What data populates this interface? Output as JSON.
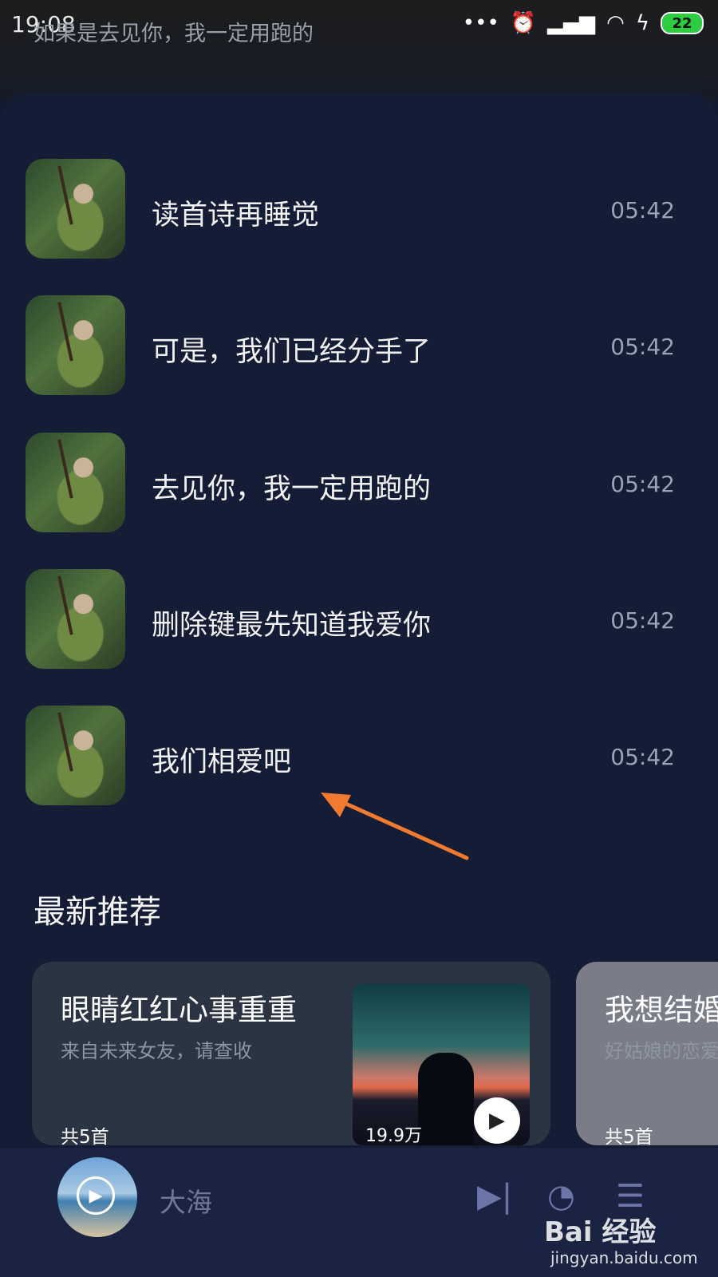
{
  "status_bar": {
    "time": "19:08",
    "notification_text": "如果是去见你，我一定用跑的",
    "battery": "22"
  },
  "songs": [
    {
      "title": "读首诗再睡觉",
      "duration": "05:42"
    },
    {
      "title": "可是，我们已经分手了",
      "duration": "05:42"
    },
    {
      "title": "去见你，我一定用跑的",
      "duration": "05:42"
    },
    {
      "title": "删除键最先知道我爱你",
      "duration": "05:42"
    },
    {
      "title": "我们相爱吧",
      "duration": "05:42"
    }
  ],
  "section": {
    "title": "最新推荐"
  },
  "cards": [
    {
      "title": "眼睛红红心事重重",
      "subtitle": "来自未来女友，请查收",
      "count": "共5首",
      "plays": "19.9万"
    },
    {
      "title": "我想结婚",
      "subtitle": "好姑娘的恋爱",
      "count": "共5首"
    }
  ],
  "player": {
    "title": "大海"
  },
  "watermark": {
    "brand": "Bai 经验",
    "url": "jingyan.baidu.com"
  },
  "colors": {
    "panel": "#141d35",
    "player": "#1b2342",
    "arrow": "#f07a30"
  }
}
